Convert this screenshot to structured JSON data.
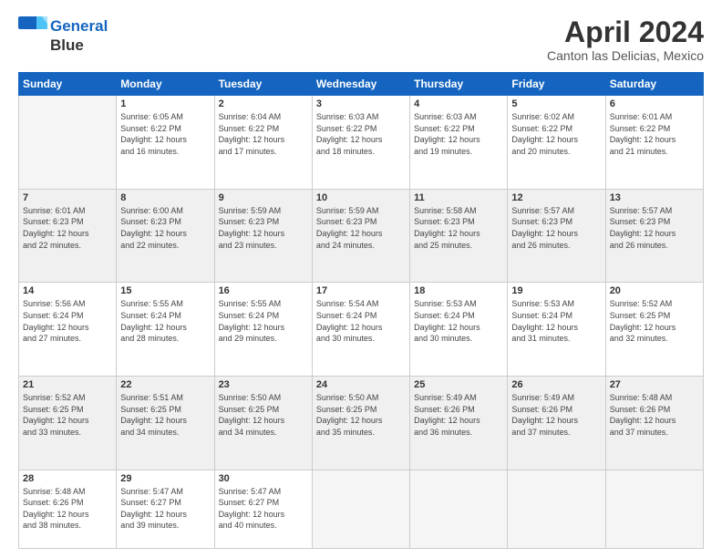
{
  "header": {
    "logo_line1": "General",
    "logo_line2": "Blue",
    "month_title": "April 2024",
    "subtitle": "Canton las Delicias, Mexico"
  },
  "days_of_week": [
    "Sunday",
    "Monday",
    "Tuesday",
    "Wednesday",
    "Thursday",
    "Friday",
    "Saturday"
  ],
  "weeks": [
    [
      {
        "day": "",
        "empty": true
      },
      {
        "day": "1",
        "sunrise": "6:05 AM",
        "sunset": "6:22 PM",
        "daylight": "12 hours and 16 minutes."
      },
      {
        "day": "2",
        "sunrise": "6:04 AM",
        "sunset": "6:22 PM",
        "daylight": "12 hours and 17 minutes."
      },
      {
        "day": "3",
        "sunrise": "6:03 AM",
        "sunset": "6:22 PM",
        "daylight": "12 hours and 18 minutes."
      },
      {
        "day": "4",
        "sunrise": "6:03 AM",
        "sunset": "6:22 PM",
        "daylight": "12 hours and 19 minutes."
      },
      {
        "day": "5",
        "sunrise": "6:02 AM",
        "sunset": "6:22 PM",
        "daylight": "12 hours and 20 minutes."
      },
      {
        "day": "6",
        "sunrise": "6:01 AM",
        "sunset": "6:22 PM",
        "daylight": "12 hours and 21 minutes."
      }
    ],
    [
      {
        "day": "7",
        "sunrise": "6:01 AM",
        "sunset": "6:23 PM",
        "daylight": "12 hours and 22 minutes."
      },
      {
        "day": "8",
        "sunrise": "6:00 AM",
        "sunset": "6:23 PM",
        "daylight": "12 hours and 22 minutes."
      },
      {
        "day": "9",
        "sunrise": "5:59 AM",
        "sunset": "6:23 PM",
        "daylight": "12 hours and 23 minutes."
      },
      {
        "day": "10",
        "sunrise": "5:59 AM",
        "sunset": "6:23 PM",
        "daylight": "12 hours and 24 minutes."
      },
      {
        "day": "11",
        "sunrise": "5:58 AM",
        "sunset": "6:23 PM",
        "daylight": "12 hours and 25 minutes."
      },
      {
        "day": "12",
        "sunrise": "5:57 AM",
        "sunset": "6:23 PM",
        "daylight": "12 hours and 26 minutes."
      },
      {
        "day": "13",
        "sunrise": "5:57 AM",
        "sunset": "6:23 PM",
        "daylight": "12 hours and 26 minutes."
      }
    ],
    [
      {
        "day": "14",
        "sunrise": "5:56 AM",
        "sunset": "6:24 PM",
        "daylight": "12 hours and 27 minutes."
      },
      {
        "day": "15",
        "sunrise": "5:55 AM",
        "sunset": "6:24 PM",
        "daylight": "12 hours and 28 minutes."
      },
      {
        "day": "16",
        "sunrise": "5:55 AM",
        "sunset": "6:24 PM",
        "daylight": "12 hours and 29 minutes."
      },
      {
        "day": "17",
        "sunrise": "5:54 AM",
        "sunset": "6:24 PM",
        "daylight": "12 hours and 30 minutes."
      },
      {
        "day": "18",
        "sunrise": "5:53 AM",
        "sunset": "6:24 PM",
        "daylight": "12 hours and 30 minutes."
      },
      {
        "day": "19",
        "sunrise": "5:53 AM",
        "sunset": "6:24 PM",
        "daylight": "12 hours and 31 minutes."
      },
      {
        "day": "20",
        "sunrise": "5:52 AM",
        "sunset": "6:25 PM",
        "daylight": "12 hours and 32 minutes."
      }
    ],
    [
      {
        "day": "21",
        "sunrise": "5:52 AM",
        "sunset": "6:25 PM",
        "daylight": "12 hours and 33 minutes."
      },
      {
        "day": "22",
        "sunrise": "5:51 AM",
        "sunset": "6:25 PM",
        "daylight": "12 hours and 34 minutes."
      },
      {
        "day": "23",
        "sunrise": "5:50 AM",
        "sunset": "6:25 PM",
        "daylight": "12 hours and 34 minutes."
      },
      {
        "day": "24",
        "sunrise": "5:50 AM",
        "sunset": "6:25 PM",
        "daylight": "12 hours and 35 minutes."
      },
      {
        "day": "25",
        "sunrise": "5:49 AM",
        "sunset": "6:26 PM",
        "daylight": "12 hours and 36 minutes."
      },
      {
        "day": "26",
        "sunrise": "5:49 AM",
        "sunset": "6:26 PM",
        "daylight": "12 hours and 37 minutes."
      },
      {
        "day": "27",
        "sunrise": "5:48 AM",
        "sunset": "6:26 PM",
        "daylight": "12 hours and 37 minutes."
      }
    ],
    [
      {
        "day": "28",
        "sunrise": "5:48 AM",
        "sunset": "6:26 PM",
        "daylight": "12 hours and 38 minutes."
      },
      {
        "day": "29",
        "sunrise": "5:47 AM",
        "sunset": "6:27 PM",
        "daylight": "12 hours and 39 minutes."
      },
      {
        "day": "30",
        "sunrise": "5:47 AM",
        "sunset": "6:27 PM",
        "daylight": "12 hours and 40 minutes."
      },
      {
        "day": "",
        "empty": true
      },
      {
        "day": "",
        "empty": true
      },
      {
        "day": "",
        "empty": true
      },
      {
        "day": "",
        "empty": true
      }
    ]
  ]
}
